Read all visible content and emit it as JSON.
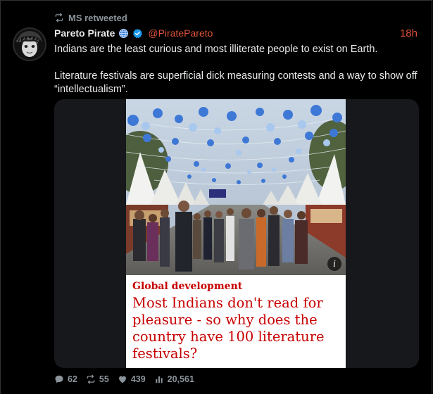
{
  "retweet": {
    "label": "MS retweeted"
  },
  "author": {
    "name": "Pareto Pirate",
    "handle": "@PiratePareto",
    "time": "18h"
  },
  "tweet": {
    "paragraphs": [
      "Indians are the least curious and most illiterate people to exist on Earth.",
      "Literature festivals are superficial dick measuring contests and a way to show off “intellectualism”."
    ]
  },
  "media": {
    "kicker": "Global development",
    "headline": "Most Indians don't read for pleasure - so why does the country have 100 literature festivals?",
    "info_glyph": "i"
  },
  "actions": {
    "replies": "62",
    "retweets": "55",
    "likes": "439",
    "views": "20,561"
  },
  "colors": {
    "accent": "#e0533a",
    "headline_red": "#c70000",
    "muted": "#8b949b",
    "verified_blue": "#1d9bf0"
  },
  "icons": [
    "retweet-icon",
    "globe-badge-icon",
    "verified-badge-icon",
    "reply-icon",
    "like-icon",
    "views-icon",
    "info-icon"
  ]
}
